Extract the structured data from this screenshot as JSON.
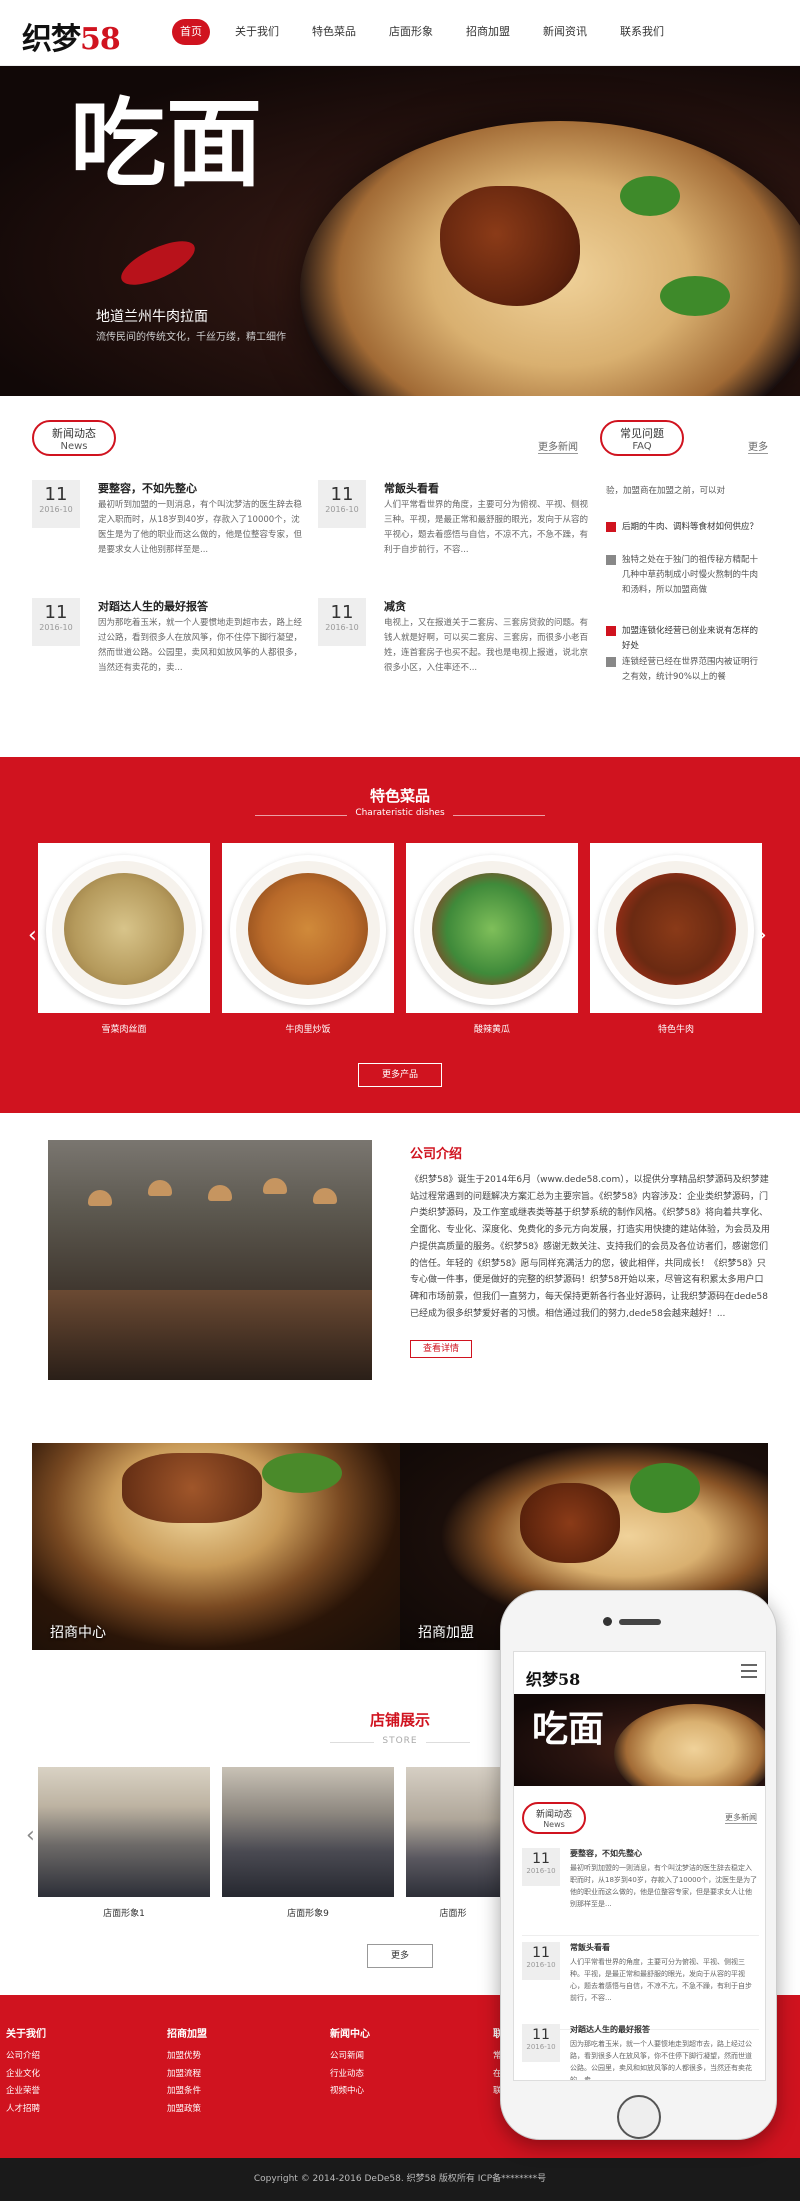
{
  "header": {
    "logo_main": "织梦",
    "logo_num": "58",
    "nav": [
      "首页",
      "关于我们",
      "特色菜品",
      "店面形象",
      "招商加盟",
      "新闻资讯",
      "联系我们"
    ]
  },
  "banner": {
    "headline": "吃面",
    "subtitle": "地道兰州牛肉拉面",
    "tagline": "流传民间的传统文化，千丝万缕，精工细作"
  },
  "news": {
    "title": "新闻动态",
    "title_en": "News",
    "more": "更多新闻",
    "items": [
      {
        "day": "11",
        "date": "2016-10",
        "title": "要整容，不如先整心",
        "summary": "最初听到加盟的一则消息，有个叫沈梦洁的医生辞去稳定入职而时，从18岁到40岁，存款入了10000个，沈医生是为了他的职业而这么做的，他是位整容专家，但是要求女人让他别那样至是..."
      },
      {
        "day": "11",
        "date": "2016-10",
        "title": "常飯头看看",
        "summary": "人们平常看世界的角度，主要可分为俯视、平视、侧视三种。平视，是最正常和最舒服的眼光，发向于从容的平视心，题去着感悟与自信，不凉不亢，不急不躁，有利于自步前行，不容..."
      },
      {
        "day": "11",
        "date": "2016-10",
        "title": "对蹈达人生的最好报答",
        "summary": "因为那吃着玉米，就一个人要惯地走到超市去，路上经过公路，看到很多人在放风筝，你不住停下脚行凝望，然而世道公路。公园里，卖风和如放风筝的人都很多，当然还有卖花的，卖..."
      },
      {
        "day": "11",
        "date": "2016-10",
        "title": "减贪",
        "summary": "电视上，又在报道关于二套房、三套房贷款的问题。有钱人就是好啊，可以买二套房、三套房，而很多小老百姓，连首套房子也买不起。我也是电视上报道，说北京很多小区，入住率还不..."
      }
    ]
  },
  "faq": {
    "title": "常见问题",
    "title_en": "FAQ",
    "more": "更多",
    "lines": [
      {
        "kind": "answer",
        "text": "验，加盟商在加盟之前，可以对"
      },
      {
        "kind": "question",
        "text": "后期的牛肉、调料等食材如何供应？"
      },
      {
        "kind": "answer",
        "text": "独特之处在于独门的祖传秘方精配十几种中草药制成小时慢火熬制的牛肉和汤料，所以加盟商做"
      },
      {
        "kind": "question",
        "text": "加盟连锁化经营已创业来说有怎样的好处"
      },
      {
        "kind": "answer",
        "text": "连锁经营已经在世界范围内被证明行之有效，统计90%以上的餐"
      }
    ]
  },
  "dishes": {
    "title": "特色菜品",
    "subtitle": "Charateristic dishes",
    "items": [
      {
        "name": "雪菜肉丝面",
        "color": "#c9b27a"
      },
      {
        "name": "牛肉里炒饭",
        "color": "#b96a2a"
      },
      {
        "name": "酸辣黄瓜",
        "color": "#3f8a3a"
      },
      {
        "name": "特色牛肉",
        "color": "#6b2a12"
      }
    ],
    "more": "更多产品",
    "prev": "‹",
    "next": "›"
  },
  "about": {
    "title": "公司介绍",
    "text": "《织梦58》诞生于2014年6月（www.dede58.com），以提供分享精品织梦源码及织梦建站过程常遇到的问题解决方案汇总为主要宗旨。《织梦58》内容涉及：企业类织梦源码，门户类织梦源码，及工作室或继表类等基于织梦系统的制作风格。《织梦58》将向着共享化、全面化、专业化、深度化、免费化的多元方向发展，打造实用快捷的建站体验，为会员及用户提供高质量的服务。《织梦58》感谢无数关注、支持我们的会员及各位访者们，感谢您们的信任。年轻的《织梦58》愿与同样充满活力的您，彼此相伴，共同成长！《织梦58》只专心做一件事，便是做好的完整的织梦源码！织梦58开始以来，尽管这有积累太多用户口碑和市场前景，但我们一直努力，每天保持更新各行各业好源码，让我织梦源码在dede58已经成为很多织梦爱好者的习惯。相信通过我们的努力,dede58会越来越好！...",
    "button": "查看详情"
  },
  "promos": [
    {
      "caption": "招商中心"
    },
    {
      "caption": "招商加盟"
    }
  ],
  "store": {
    "title": "店铺展示",
    "subtitle": "STORE",
    "items": [
      "店面形象1",
      "店面形象9",
      "店面形"
    ],
    "more": "更多",
    "prev": "‹"
  },
  "footer": {
    "columns": [
      {
        "title": "关于我们",
        "links": [
          "公司介绍",
          "企业文化",
          "企业荣誉",
          "人才招聘"
        ]
      },
      {
        "title": "招商加盟",
        "links": [
          "加盟优势",
          "加盟流程",
          "加盟条件",
          "加盟政策"
        ]
      },
      {
        "title": "新闻中心",
        "links": [
          "公司新闻",
          "行业动态",
          "视频中心"
        ]
      },
      {
        "title": "联",
        "links": [
          "常",
          "在",
          "联"
        ]
      }
    ],
    "copyright": "Copyright © 2014-2016 DeDe58. 织梦58 版权所有    ICP备********号"
  },
  "mobile": {
    "logo": "织梦58",
    "banner": "吃面",
    "news_title": "新闻动态",
    "news_en": "News",
    "more": "更多新闻",
    "items": [
      {
        "day": "11",
        "date": "2016-10",
        "title": "要整容，不如先整心",
        "summary": "最初听到加盟的一则消息，有个叫沈梦洁的医生辞去稳定入职而时，从18岁到40岁，存款入了10000个，沈医生是为了他的职业而这么做的，他是位整容专家，但是要求女人让他别那样至是..."
      },
      {
        "day": "11",
        "date": "2016-10",
        "title": "常飯头看看",
        "summary": "人们平常看世界的角度，主要可分为俯视、平视、侧视三种。平视，是最正常和最舒服的眼光，发向于从容的平视心，题去着感悟与自信，不凉不亢，不急不躁，有利于自步前行，不容..."
      },
      {
        "day": "11",
        "date": "2016-10",
        "title": "对蹈达人生的最好报答",
        "summary": "因为那吃着玉米，就一个人要惯地走到超市去，路上经过公路，看到很多人在放风筝，你不住停下脚行凝望，然而世道公路。公园里，卖风和如放风筝的人都很多，当然还有卖花的，卖..."
      }
    ]
  }
}
